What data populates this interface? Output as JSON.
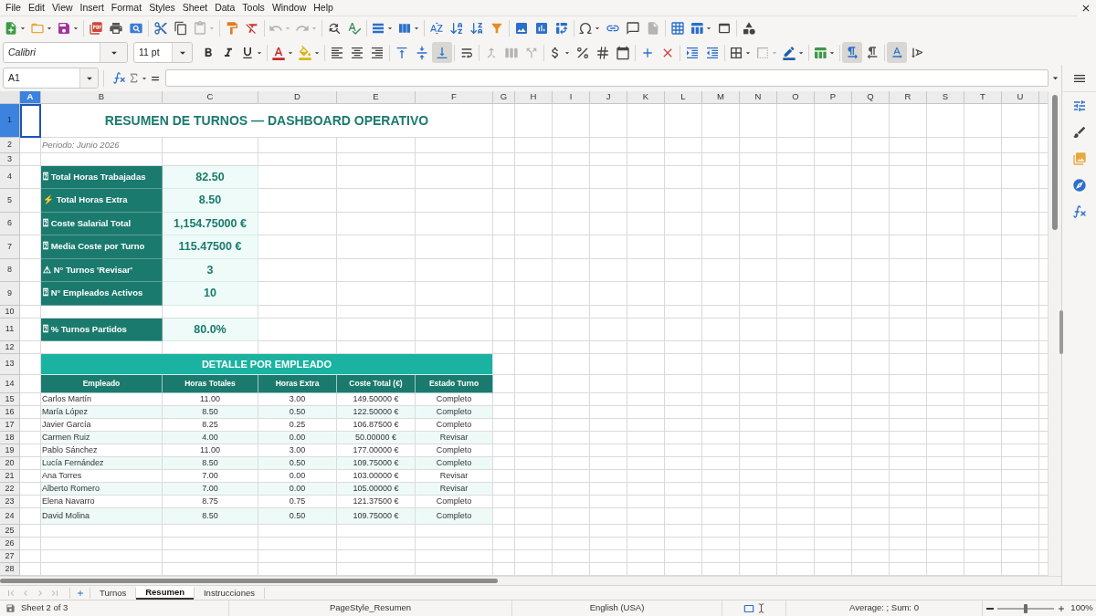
{
  "menu_bar": [
    "File",
    "Edit",
    "View",
    "Insert",
    "Format",
    "Styles",
    "Sheet",
    "Data",
    "Tools",
    "Window",
    "Help"
  ],
  "standard_toolbar": {
    "groups": [
      [
        {
          "kind": "new",
          "dropdown": true,
          "disabled": false
        },
        {
          "kind": "open",
          "dropdown": true,
          "disabled": false
        },
        {
          "kind": "save",
          "dropdown": true,
          "disabled": false
        }
      ],
      [
        {
          "kind": "export_pdf",
          "dropdown": false,
          "disabled": false
        },
        {
          "kind": "print",
          "dropdown": false,
          "disabled": false
        },
        {
          "kind": "print_preview",
          "dropdown": false,
          "disabled": false
        }
      ],
      [
        {
          "kind": "cut",
          "dropdown": false,
          "disabled": false
        },
        {
          "kind": "copy",
          "dropdown": false,
          "disabled": false
        },
        {
          "kind": "paste",
          "dropdown": true,
          "disabled": true
        }
      ],
      [
        {
          "kind": "clone",
          "dropdown": false,
          "disabled": false
        },
        {
          "kind": "clear_formatting",
          "dropdown": false,
          "disabled": false
        }
      ],
      [
        {
          "kind": "undo",
          "dropdown": true,
          "disabled": true
        },
        {
          "kind": "redo",
          "dropdown": true,
          "disabled": true
        }
      ],
      [
        {
          "kind": "find_replace",
          "dropdown": false,
          "disabled": false
        },
        {
          "kind": "spelling",
          "dropdown": false,
          "disabled": false
        }
      ],
      [
        {
          "kind": "row",
          "dropdown": true,
          "disabled": false
        },
        {
          "kind": "column",
          "dropdown": true,
          "disabled": false
        }
      ],
      [
        {
          "kind": "sort",
          "dropdown": false,
          "disabled": false
        },
        {
          "kind": "sort_ascending",
          "dropdown": false,
          "disabled": false
        },
        {
          "kind": "sort_descending",
          "dropdown": false,
          "disabled": false
        },
        {
          "kind": "autofilter",
          "dropdown": false,
          "disabled": false
        }
      ],
      [
        {
          "kind": "image",
          "dropdown": false,
          "disabled": false
        },
        {
          "kind": "chart",
          "dropdown": false,
          "disabled": false
        },
        {
          "kind": "pivot_table",
          "dropdown": false,
          "disabled": false
        }
      ],
      [
        {
          "kind": "special_character",
          "dropdown": true,
          "disabled": false
        },
        {
          "kind": "hyperlink",
          "dropdown": false,
          "disabled": false
        },
        {
          "kind": "comment",
          "dropdown": false,
          "disabled": false
        },
        {
          "kind": "headers_footers",
          "dropdown": false,
          "disabled": true
        }
      ],
      [
        {
          "kind": "print_area",
          "dropdown": false,
          "disabled": false
        },
        {
          "kind": "freeze",
          "dropdown": true,
          "disabled": false
        },
        {
          "kind": "split_window",
          "dropdown": false,
          "disabled": false
        }
      ],
      [
        {
          "kind": "shapes",
          "dropdown": false,
          "disabled": false
        }
      ]
    ]
  },
  "formatting_toolbar": {
    "font_name": "Calibri",
    "font_size": "11 pt",
    "groups": [
      [
        {
          "kind": "bold",
          "dropdown": false,
          "disabled": false,
          "pressed": false
        },
        {
          "kind": "italic",
          "dropdown": false,
          "disabled": false,
          "pressed": false
        },
        {
          "kind": "underline",
          "dropdown": true,
          "disabled": false,
          "pressed": false
        }
      ],
      [
        {
          "kind": "font_color",
          "dropdown": true,
          "disabled": false,
          "pressed": false
        },
        {
          "kind": "highlight",
          "dropdown": true,
          "disabled": false,
          "pressed": false
        }
      ],
      [
        {
          "kind": "align_left",
          "dropdown": false,
          "disabled": false,
          "pressed": false
        },
        {
          "kind": "align_center",
          "dropdown": false,
          "disabled": false,
          "pressed": false
        },
        {
          "kind": "align_right",
          "dropdown": false,
          "disabled": false,
          "pressed": false
        }
      ],
      [
        {
          "kind": "align_top",
          "dropdown": false,
          "disabled": false,
          "pressed": false
        },
        {
          "kind": "align_middle",
          "dropdown": false,
          "disabled": false,
          "pressed": false
        },
        {
          "kind": "align_bottom",
          "dropdown": false,
          "disabled": false,
          "pressed": true
        }
      ],
      [
        {
          "kind": "wrap_text",
          "dropdown": false,
          "disabled": false,
          "pressed": false
        }
      ],
      [
        {
          "kind": "merge_center",
          "dropdown": false,
          "disabled": true,
          "pressed": false
        },
        {
          "kind": "merge",
          "dropdown": false,
          "disabled": true,
          "pressed": false
        },
        {
          "kind": "unmerge",
          "dropdown": false,
          "disabled": true,
          "pressed": false
        }
      ],
      [
        {
          "kind": "currency",
          "dropdown": true,
          "disabled": false,
          "pressed": false
        },
        {
          "kind": "percent",
          "dropdown": false,
          "disabled": false,
          "pressed": false
        },
        {
          "kind": "number",
          "dropdown": false,
          "disabled": false,
          "pressed": false
        },
        {
          "kind": "date",
          "dropdown": false,
          "disabled": false,
          "pressed": false
        }
      ],
      [
        {
          "kind": "add_decimal",
          "dropdown": false,
          "disabled": false,
          "pressed": false
        },
        {
          "kind": "delete_decimal",
          "dropdown": false,
          "disabled": false,
          "pressed": false
        }
      ],
      [
        {
          "kind": "indent_increase",
          "dropdown": false,
          "disabled": false,
          "pressed": false
        },
        {
          "kind": "indent_decrease",
          "dropdown": false,
          "disabled": false,
          "pressed": false
        }
      ],
      [
        {
          "kind": "borders",
          "dropdown": true,
          "disabled": false,
          "pressed": false
        },
        {
          "kind": "border_style",
          "dropdown": true,
          "disabled": true,
          "pressed": false
        },
        {
          "kind": "border_color",
          "dropdown": true,
          "disabled": false,
          "pressed": false
        }
      ],
      [
        {
          "kind": "conditional",
          "dropdown": true,
          "disabled": false,
          "pressed": false
        }
      ],
      [
        {
          "kind": "paragraph_ltr",
          "dropdown": false,
          "disabled": false,
          "pressed": true
        },
        {
          "kind": "paragraph_rtl",
          "dropdown": false,
          "disabled": false,
          "pressed": false
        }
      ],
      [
        {
          "kind": "text_horizontal",
          "dropdown": false,
          "disabled": false,
          "pressed": true
        },
        {
          "kind": "text_vertical",
          "dropdown": false,
          "disabled": false,
          "pressed": false
        }
      ]
    ]
  },
  "formula_bar": {
    "cell_reference": "A1"
  },
  "sheet": {
    "columns": [
      {
        "label": "A",
        "selected": true
      },
      {
        "label": "B",
        "selected": false
      },
      {
        "label": "C",
        "selected": false
      },
      {
        "label": "D",
        "selected": false
      },
      {
        "label": "E",
        "selected": false
      },
      {
        "label": "F",
        "selected": false
      },
      {
        "label": "G",
        "selected": false
      },
      {
        "label": "H",
        "selected": false
      },
      {
        "label": "I",
        "selected": false
      },
      {
        "label": "J",
        "selected": false
      },
      {
        "label": "K",
        "selected": false
      },
      {
        "label": "L",
        "selected": false
      },
      {
        "label": "M",
        "selected": false
      },
      {
        "label": "N",
        "selected": false
      },
      {
        "label": "O",
        "selected": false
      },
      {
        "label": "P",
        "selected": false
      },
      {
        "label": "Q",
        "selected": false
      },
      {
        "label": "R",
        "selected": false
      },
      {
        "label": "S",
        "selected": false
      },
      {
        "label": "T",
        "selected": false
      },
      {
        "label": "U",
        "selected": false
      }
    ],
    "rows": [
      {
        "header": "1",
        "selected": true,
        "kind": "title",
        "cells": [
          "RESUMEN DE TURNOS — DASHBOARD OPERATIVO"
        ]
      },
      {
        "header": "2",
        "selected": false,
        "kind": "note",
        "cells": [
          "Periodo: Junio 2026"
        ]
      },
      {
        "header": "3",
        "selected": false,
        "kind": "blank"
      },
      {
        "header": "4",
        "selected": false,
        "kind": "kpi",
        "cells": [
          "⍰ Total Horas Trabajadas",
          "82.50"
        ]
      },
      {
        "header": "5",
        "selected": false,
        "kind": "kpi",
        "cells": [
          "⚡ Total Horas Extra",
          "8.50"
        ]
      },
      {
        "header": "6",
        "selected": false,
        "kind": "kpi",
        "cells": [
          "⍰ Coste Salarial Total",
          "1,154.75000 €"
        ]
      },
      {
        "header": "7",
        "selected": false,
        "kind": "kpi",
        "cells": [
          "⍰ Media Coste por Turno",
          "115.47500 €"
        ]
      },
      {
        "header": "8",
        "selected": false,
        "kind": "kpi",
        "cells": [
          "⚠ N° Turnos 'Revisar'",
          "3"
        ]
      },
      {
        "header": "9",
        "selected": false,
        "kind": "kpi",
        "cells": [
          "⍰ N° Empleados Activos",
          "10"
        ]
      },
      {
        "header": "10",
        "selected": false,
        "kind": "blank"
      },
      {
        "header": "11",
        "selected": false,
        "kind": "kpi",
        "cells": [
          "⍰ % Turnos Partidos",
          "80.0%"
        ]
      },
      {
        "header": "12",
        "selected": false,
        "kind": "blank"
      },
      {
        "header": "13",
        "selected": false,
        "kind": "section",
        "cells": [
          "DETALLE POR EMPLEADO"
        ]
      },
      {
        "header": "14",
        "selected": false,
        "kind": "table_header",
        "cells": [
          "Empleado",
          "Horas Totales",
          "Horas Extra",
          "Coste Total (€)",
          "Estado Turno"
        ]
      },
      {
        "header": "15",
        "selected": false,
        "kind": "data",
        "cells": [
          "Carlos Martín",
          "11.00",
          "3.00",
          "149.50000 €",
          "Completo"
        ]
      },
      {
        "header": "16",
        "selected": false,
        "kind": "data",
        "cells": [
          "María López",
          "8.50",
          "0.50",
          "122.50000 €",
          "Completo"
        ]
      },
      {
        "header": "17",
        "selected": false,
        "kind": "data",
        "cells": [
          "Javier García",
          "8.25",
          "0.25",
          "106.87500 €",
          "Completo"
        ]
      },
      {
        "header": "18",
        "selected": false,
        "kind": "data",
        "cells": [
          "Carmen Ruiz",
          "4.00",
          "0.00",
          "50.00000 €",
          "Revisar"
        ]
      },
      {
        "header": "19",
        "selected": false,
        "kind": "data",
        "cells": [
          "Pablo Sánchez",
          "11.00",
          "3.00",
          "177.00000 €",
          "Completo"
        ]
      },
      {
        "header": "20",
        "selected": false,
        "kind": "data",
        "cells": [
          "Lucía Fernández",
          "8.50",
          "0.50",
          "109.75000 €",
          "Completo"
        ]
      },
      {
        "header": "21",
        "selected": false,
        "kind": "data",
        "cells": [
          "Ana Torres",
          "7.00",
          "0.00",
          "103.00000 €",
          "Revisar"
        ]
      },
      {
        "header": "22",
        "selected": false,
        "kind": "data",
        "cells": [
          "Alberto Romero",
          "7.00",
          "0.00",
          "105.00000 €",
          "Revisar"
        ]
      },
      {
        "header": "23",
        "selected": false,
        "kind": "data",
        "cells": [
          "Elena Navarro",
          "8.75",
          "0.75",
          "121.37500 €",
          "Completo"
        ]
      },
      {
        "header": "24",
        "selected": false,
        "kind": "data",
        "cells": [
          "David Molina",
          "8.50",
          "0.50",
          "109.75000 €",
          "Completo"
        ]
      },
      {
        "header": "25",
        "selected": false,
        "kind": "blank"
      },
      {
        "header": "26",
        "selected": false,
        "kind": "blank"
      },
      {
        "header": "27",
        "selected": false,
        "kind": "blank"
      },
      {
        "header": "28",
        "selected": false,
        "kind": "blank"
      }
    ]
  },
  "tab_bar": {
    "navigation_disabled": true,
    "tabs": [
      {
        "label": "Turnos",
        "selected": false
      },
      {
        "label": "Resumen",
        "selected": true
      },
      {
        "label": "Instrucciones",
        "selected": false
      }
    ]
  },
  "status_bar": {
    "sheet_position": "Sheet 2 of 3",
    "page_style": "PageStyle_Resumen",
    "language": "English (USA)",
    "selection_summary": "Average: ; Sum: 0",
    "zoom": {
      "level": 0.5,
      "reading": "100%"
    }
  }
}
